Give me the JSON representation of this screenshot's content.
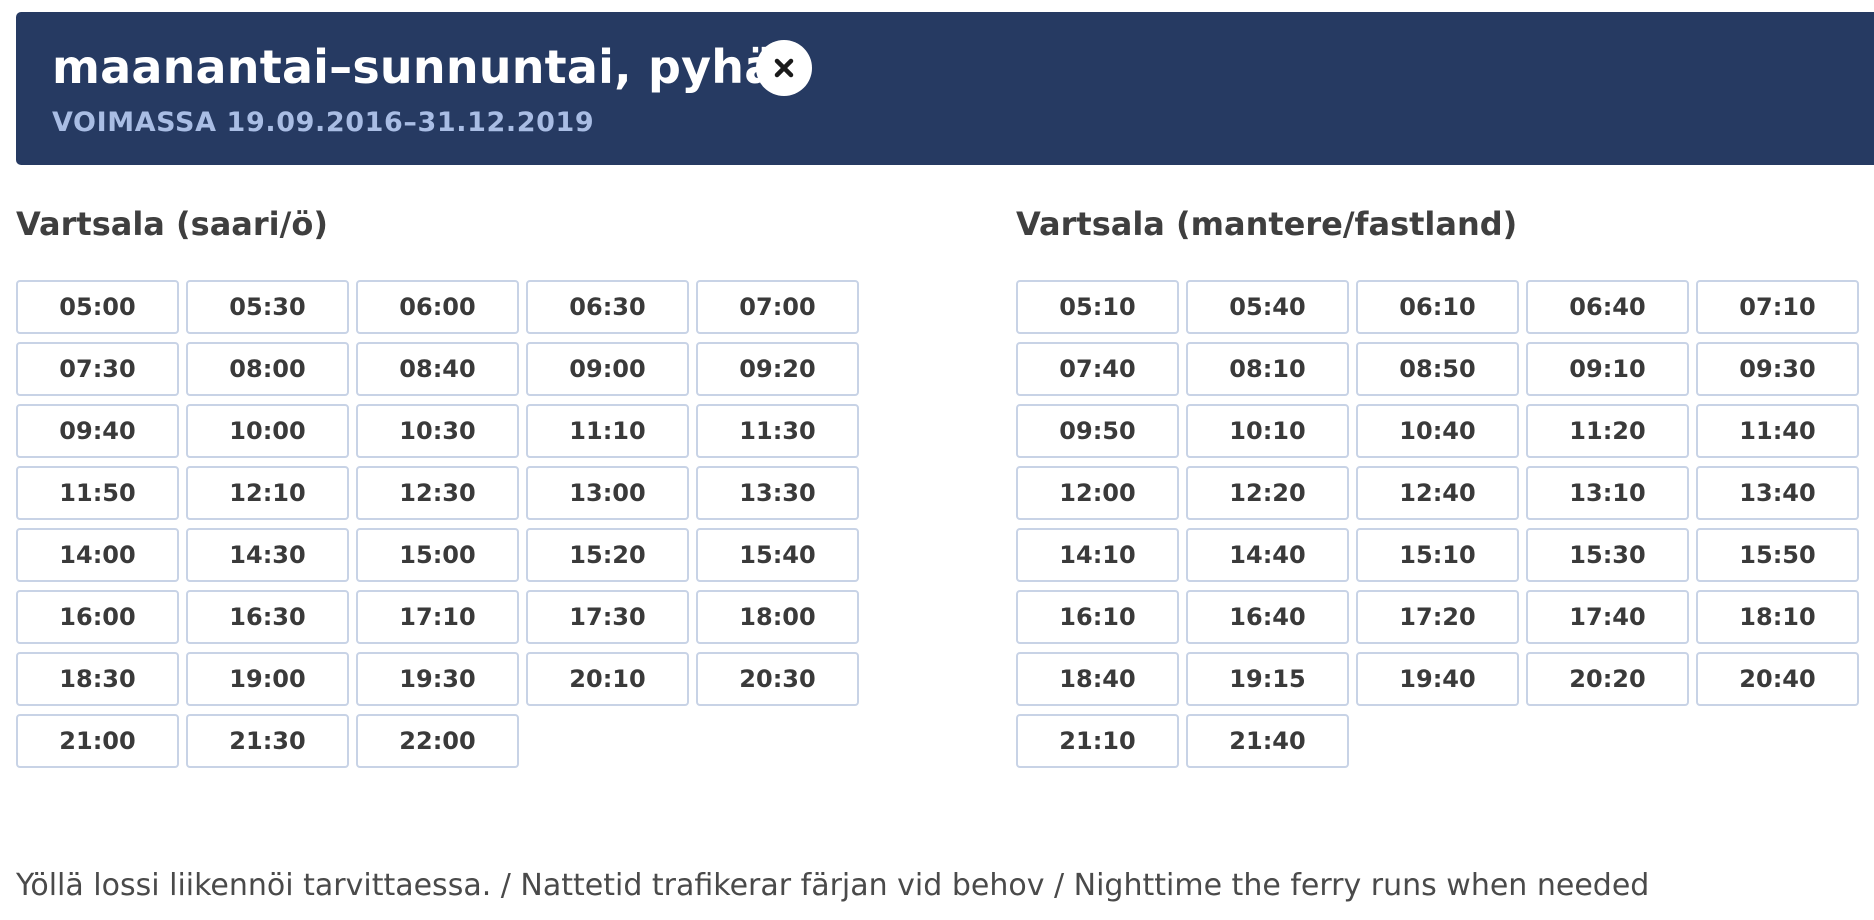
{
  "header": {
    "title": "maanantai–sunnuntai, pyhät",
    "validity": "VOIMASSA 19.09.2016–31.12.2019",
    "close_icon": "close-icon"
  },
  "columns": [
    {
      "title": "Vartsala (saari/ö)",
      "times": [
        "05:00",
        "05:30",
        "06:00",
        "06:30",
        "07:00",
        "07:30",
        "08:00",
        "08:40",
        "09:00",
        "09:20",
        "09:40",
        "10:00",
        "10:30",
        "11:10",
        "11:30",
        "11:50",
        "12:10",
        "12:30",
        "13:00",
        "13:30",
        "14:00",
        "14:30",
        "15:00",
        "15:20",
        "15:40",
        "16:00",
        "16:30",
        "17:10",
        "17:30",
        "18:00",
        "18:30",
        "19:00",
        "19:30",
        "20:10",
        "20:30",
        "21:00",
        "21:30",
        "22:00"
      ]
    },
    {
      "title": "Vartsala (mantere/fastland)",
      "times": [
        "05:10",
        "05:40",
        "06:10",
        "06:40",
        "07:10",
        "07:40",
        "08:10",
        "08:50",
        "09:10",
        "09:30",
        "09:50",
        "10:10",
        "10:40",
        "11:20",
        "11:40",
        "12:00",
        "12:20",
        "12:40",
        "13:10",
        "13:40",
        "14:10",
        "14:40",
        "15:10",
        "15:30",
        "15:50",
        "16:10",
        "16:40",
        "17:20",
        "17:40",
        "18:10",
        "18:40",
        "19:15",
        "19:40",
        "20:20",
        "20:40",
        "21:10",
        "21:40"
      ]
    }
  ],
  "footnote": "Yöllä lossi liikennöi tarvittaessa. / Nattetid trafikerar färjan vid behov / Nighttime the ferry runs when needed",
  "colors": {
    "header_bg": "#263a62",
    "validity_text": "#a9bde4",
    "button_border": "#c8d3e6"
  }
}
